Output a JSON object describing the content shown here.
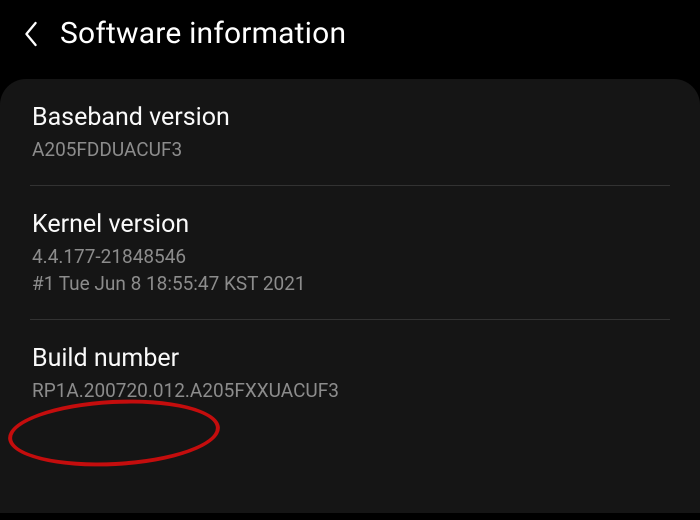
{
  "header": {
    "title": "Software information"
  },
  "items": [
    {
      "title": "Baseband version",
      "lines": [
        "A205FDDUACUF3"
      ]
    },
    {
      "title": "Kernel version",
      "lines": [
        "4.4.177-21848546",
        "#1 Tue Jun 8 18:55:47 KST 2021"
      ]
    },
    {
      "title": "Build number",
      "lines": [
        "RP1A.200720.012.A205FXXUACUF3"
      ]
    }
  ],
  "highlight": {
    "target": "Build number",
    "color": "#c40d0d"
  }
}
